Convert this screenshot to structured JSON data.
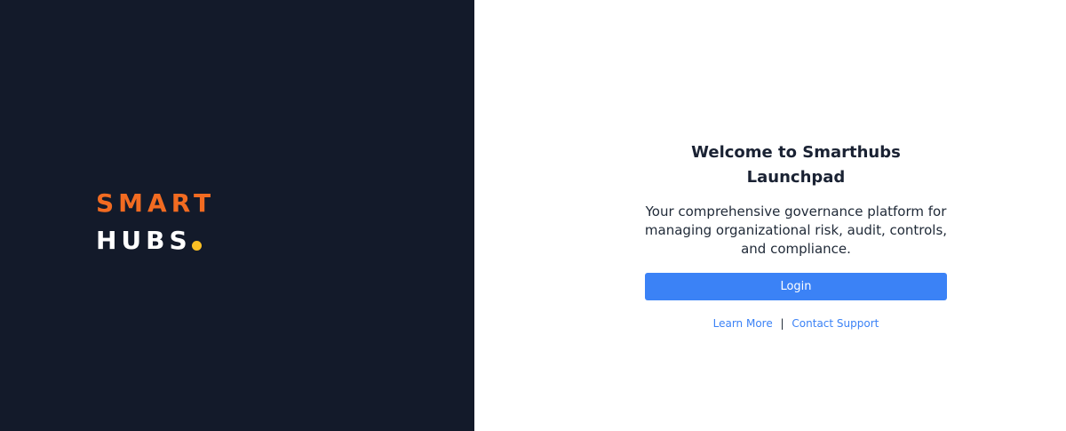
{
  "brand": {
    "line1": "SMART",
    "line2": "HUBS",
    "colors": {
      "background": "#131a2a",
      "smart": "#f26b21",
      "hubs": "#ffffff",
      "dot": "#fbbf24"
    }
  },
  "welcome": {
    "title": "Welcome to Smarthubs Launchpad",
    "description": "Your comprehensive governance platform for managing organizational risk, audit, controls, and compliance.",
    "login_label": "Login",
    "accent": "#3b82f6"
  },
  "links": {
    "learn_more": "Learn More",
    "separator": "|",
    "contact_support": "Contact Support"
  }
}
